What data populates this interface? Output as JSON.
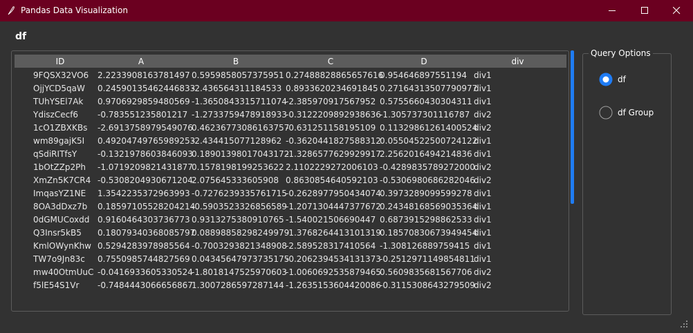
{
  "window": {
    "title": "Pandas Data Visualization",
    "colors": {
      "titlebar": "#6b0020",
      "background": "#323232",
      "accent": "#1f7cf5"
    }
  },
  "table_title": "df",
  "table": {
    "columns": [
      "ID",
      "A",
      "B",
      "C",
      "D",
      "div"
    ],
    "rows": [
      [
        "9FQSX32VO6",
        "2.2233908163781497",
        "0.5959858057375951",
        "0.27488828865657616",
        "0.954646897551194",
        "div1"
      ],
      [
        "OjjYCD5qaW",
        "0.24590135462446833",
        "-2.436564311184533",
        "0.8933620234691845",
        "0.27164313507790977",
        "div1"
      ],
      [
        "TUhYSEl7Ak",
        "0.9706929859480569",
        "-1.3650843315711074",
        "-2.385970917567952",
        "0.5755660430304311",
        "div1"
      ],
      [
        "YdiszCecf6",
        "-0.783551235801217",
        "-1.2733759478918933",
        "-0.3122209892938636",
        "-1.305737301116787",
        "div2"
      ],
      [
        "1cO1ZBXKBs",
        "-2.6913758979549076",
        "0.46236773086163757",
        "-0.631251158195109",
        "0.11329861261400524",
        "div2"
      ],
      [
        "wm89gajK5I",
        "0.49204749765989253",
        "-2.434415077128962",
        "-0.3620441827588312",
        "0.05504522500724122",
        "div1"
      ],
      [
        "qSdiRITfsY",
        "-0.1321978603846093",
        "0.18901398017043172",
        "-1.3286577629929917",
        "2.2562016494214836",
        "div1"
      ],
      [
        "1bOtZZp2Ph",
        "-1.0719209821431877",
        "0.1578198199253622",
        "2.1102229272006103",
        "-0.4289835789272000",
        "div2"
      ],
      [
        "XmZn5K7CR4",
        "-0.5308204930671204",
        "2.075645333605908",
        "0.8630854640592103",
        "-0.5306980686282046",
        "div2"
      ],
      [
        "ImqasYZ1NE",
        "1.3542235372963993",
        "-0.7276239335761715",
        "-0.2628977950434074",
        "0.3973289099599278",
        "div1"
      ],
      [
        "8OA3dDxz7b",
        "0.18597105528204214",
        "-0.5903523326856589",
        "-1.2071304447377672",
        "0.24348168569035364",
        "div1"
      ],
      [
        "0dGMUCoxdd",
        "0.9160464303736773",
        "0.9313275380910765",
        "-1.540021506690447",
        "0.6873915298862533",
        "div1"
      ],
      [
        "Q3Insr5kB5",
        "0.18079340368085797",
        "0.08898858298249979",
        "-1.3768264413101319",
        "0.18570830673949454",
        "div1"
      ],
      [
        "KmlOWynKhw",
        "0.5294283978985564",
        "-0.7003293821348908",
        "-2.589528317410564",
        "-1.308126889759415",
        "div1"
      ],
      [
        "TW7o9Jn83c",
        "0.7550985744827569",
        "0.04345647973735175",
        "-0.2062394534131373",
        "-0.2512971149854811",
        "div1"
      ],
      [
        "mw40OtmUuC",
        "-0.0416933605330524",
        "-1.8018147525970603",
        "-1.0060692535879465",
        "0.5609835681567706",
        "div2"
      ],
      [
        "f5lE54S1Vr",
        "-0.7484443066656867",
        "1.3007286597287144",
        "-1.2635153604420086",
        "-0.3115308643279509",
        "div2"
      ]
    ]
  },
  "query_options": {
    "title": "Query Options",
    "options": [
      {
        "label": "df",
        "selected": true
      },
      {
        "label": "df Group",
        "selected": false
      }
    ]
  },
  "icons": {
    "app": "feather-icon",
    "minimize": "minimize-icon",
    "maximize": "maximize-icon",
    "close": "close-icon",
    "resize": "resize-grip-icon"
  }
}
